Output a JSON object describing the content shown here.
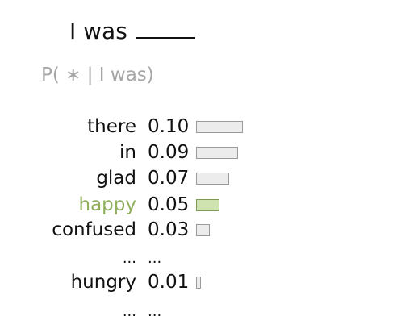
{
  "prompt": {
    "text": "I was"
  },
  "prob_label": "P( ∗ | I was)",
  "rows": [
    {
      "word": "there",
      "prob": "0.10",
      "value": 0.1
    },
    {
      "word": "in",
      "prob": "0.09",
      "value": 0.09
    },
    {
      "word": "glad",
      "prob": "0.07",
      "value": 0.07
    },
    {
      "word": "happy",
      "prob": "0.05",
      "value": 0.05,
      "highlight": true
    },
    {
      "word": "confused",
      "prob": "0.03",
      "value": 0.03
    },
    {
      "word": "...",
      "prob": "...",
      "ellipsis": true
    },
    {
      "word": "hungry",
      "prob": "0.01",
      "value": 0.01
    },
    {
      "word": "...",
      "prob": "...",
      "ellipsis": true
    }
  ],
  "colors": {
    "highlight_text": "#8fae5a",
    "highlight_bar": "#cfe3b0",
    "bar_fill": "#ececec",
    "bar_border": "#9a9a9a"
  }
}
